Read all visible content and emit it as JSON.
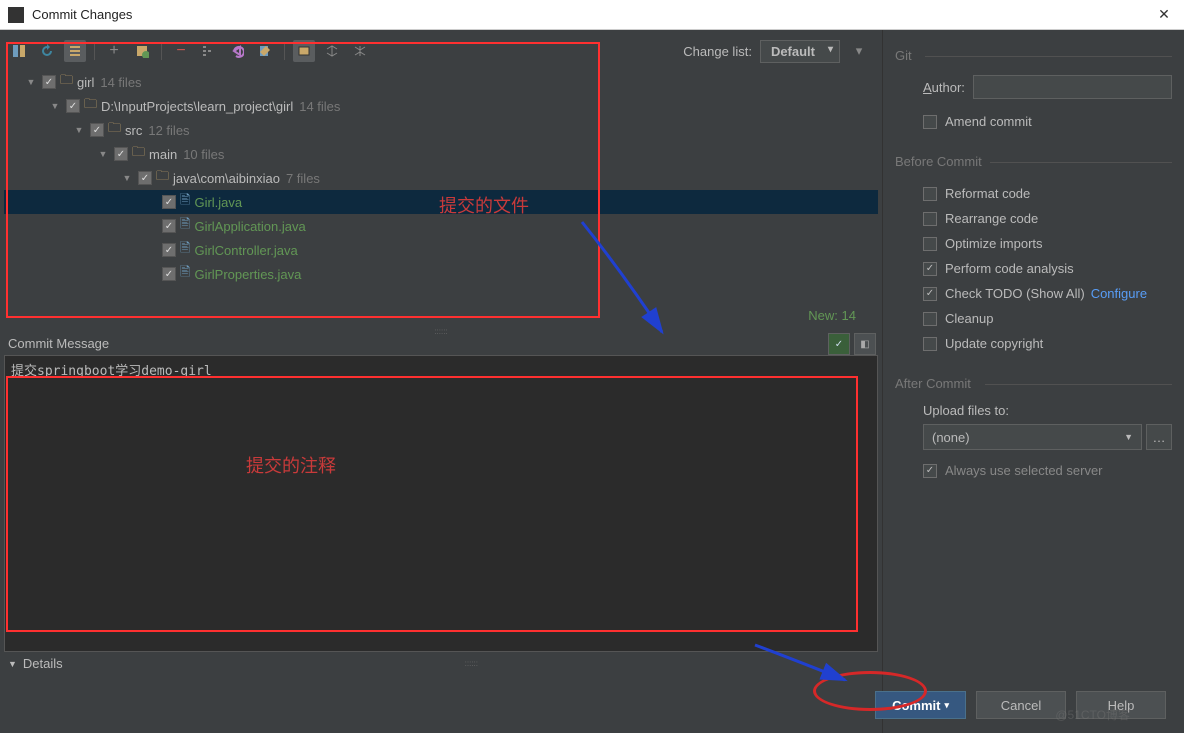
{
  "titlebar": {
    "title": "Commit Changes",
    "close": "✕"
  },
  "changelist": {
    "label": "Change list:",
    "value": "Default"
  },
  "tree": [
    {
      "indent": 0,
      "arrow": "▼",
      "check": true,
      "icon": "folder",
      "label": "girl",
      "count": "14 files",
      "green": false
    },
    {
      "indent": 1,
      "arrow": "▼",
      "check": true,
      "icon": "folder",
      "label": "D:\\InputProjects\\learn_project\\girl",
      "count": "14 files",
      "green": false
    },
    {
      "indent": 2,
      "arrow": "▼",
      "check": true,
      "icon": "folder",
      "label": "src",
      "count": "12 files",
      "green": false
    },
    {
      "indent": 3,
      "arrow": "▼",
      "check": true,
      "icon": "folder",
      "label": "main",
      "count": "10 files",
      "green": false
    },
    {
      "indent": 4,
      "arrow": "▼",
      "check": true,
      "icon": "folder",
      "label": "java\\com\\aibinxiao",
      "count": "7 files",
      "green": false
    },
    {
      "indent": 5,
      "arrow": "",
      "check": true,
      "icon": "file",
      "label": "Girl.java",
      "count": "",
      "green": true,
      "selected": true
    },
    {
      "indent": 5,
      "arrow": "",
      "check": true,
      "icon": "file",
      "label": "GirlApplication.java",
      "count": "",
      "green": true
    },
    {
      "indent": 5,
      "arrow": "",
      "check": true,
      "icon": "file",
      "label": "GirlController.java",
      "count": "",
      "green": true
    },
    {
      "indent": 5,
      "arrow": "",
      "check": true,
      "icon": "file",
      "label": "GirlProperties.java",
      "count": "",
      "green": true
    }
  ],
  "status": {
    "new_count": "New: 14"
  },
  "commit_msg": {
    "label": "Commit Message",
    "value": "提交springboot学习demo-girl"
  },
  "details": {
    "label": "Details"
  },
  "git": {
    "title": "Git",
    "author_label": "Author:",
    "author_value": "",
    "amend_label": "Amend commit"
  },
  "before": {
    "title": "Before Commit",
    "items": [
      {
        "checked": false,
        "label": "Reformat code",
        "u": "R"
      },
      {
        "checked": false,
        "label": "Rearrange code",
        "u": ""
      },
      {
        "checked": false,
        "label": "Optimize imports",
        "u": "O"
      },
      {
        "checked": true,
        "label": "Perform code analysis",
        "u": ""
      },
      {
        "checked": true,
        "label": "Check TODO (Show All)",
        "u": "",
        "link": "Configure"
      },
      {
        "checked": false,
        "label": "Cleanup",
        "u": ""
      },
      {
        "checked": false,
        "label": "Update copyright",
        "u": ""
      }
    ]
  },
  "after": {
    "title": "After Commit",
    "upload_label": "Upload files to:",
    "upload_value": "(none)",
    "always_label": "Always use selected server"
  },
  "buttons": {
    "commit": "Commit",
    "cancel": "Cancel",
    "help": "Help"
  },
  "annotations": {
    "files_label": "提交的文件",
    "msg_label": "提交的注释"
  },
  "watermark": "@51CTO博客"
}
